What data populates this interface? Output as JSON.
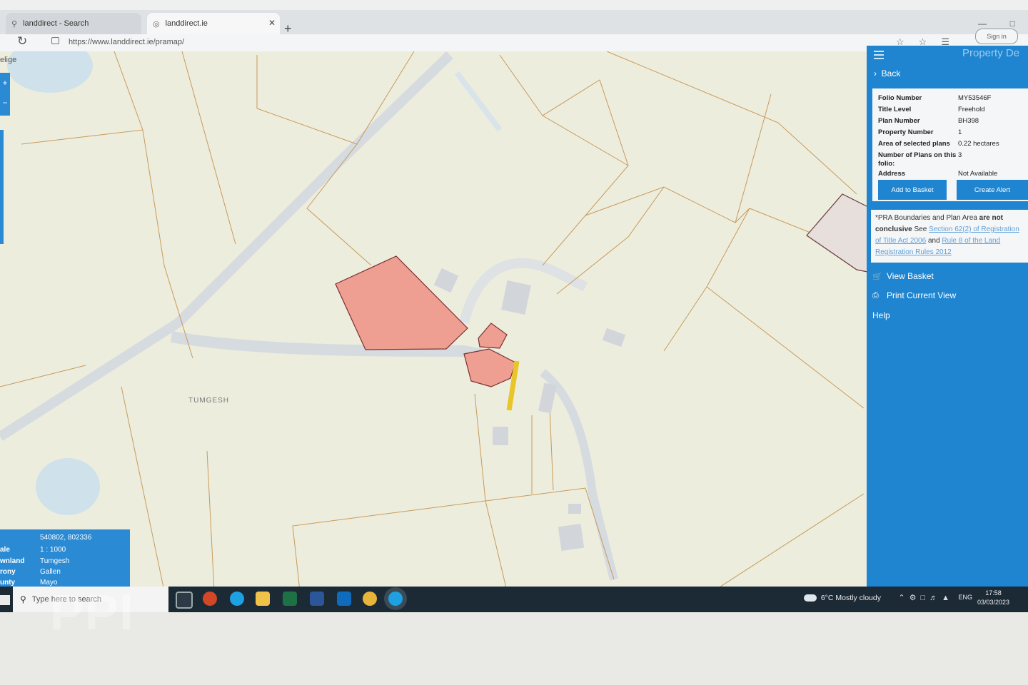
{
  "browser": {
    "tabs": [
      {
        "label": "landdirect - Search",
        "icon": "search-icon"
      },
      {
        "label": "landdirect.ie",
        "icon": "globe-icon"
      }
    ],
    "url": "https://www.landdirect.ie/pramap/",
    "signin_label": "Sign in"
  },
  "map": {
    "partial_label": "elige",
    "townland_label": "TUMGESH",
    "zoom_in": "+",
    "zoom_out": "−",
    "parcel_color": "#ef9f92",
    "boundary_color": "#c89a5a",
    "road_color": "#d6dbe0",
    "highlight_color": "#e8c62a"
  },
  "info_box": {
    "coords": "540802, 802336",
    "rows": [
      {
        "key": "ale",
        "value": "1 : 1000"
      },
      {
        "key": "wnland",
        "value": "Tumgesh"
      },
      {
        "key": "rony",
        "value": "Gallen"
      },
      {
        "key": "unty",
        "value": "Mayo"
      }
    ]
  },
  "panel": {
    "title": "Property De",
    "back_label": "Back",
    "details": [
      {
        "key": "Folio Number",
        "value": "MY53546F"
      },
      {
        "key": "Title Level",
        "value": "Freehold"
      },
      {
        "key": "Plan Number",
        "value": "BH398"
      },
      {
        "key": "Property Number",
        "value": "1"
      },
      {
        "key": "Area of selected plans",
        "value": "0.22 hectares"
      },
      {
        "key": "Number of Plans on this folio:",
        "value": "3"
      },
      {
        "key": "Address",
        "value": "Not Available"
      }
    ],
    "add_to_basket": "Add to Basket",
    "create_alert": "Create Alert",
    "notice": {
      "prefix": "*PRA Boundaries and Plan Area",
      "bold": "are not conclusive",
      "see": "See",
      "link1": "Section 62(2) of Registration of Title Act 2006",
      "and": "and",
      "link2": "Rule 8 of the Land Registration Rules 2012"
    },
    "links": [
      {
        "label": "View Basket",
        "icon": "cart-icon"
      },
      {
        "label": "Print Current View",
        "icon": "printer-icon"
      },
      {
        "label": "Help",
        "icon": ""
      }
    ],
    "accent": "#1f85d0"
  },
  "taskbar": {
    "search_placeholder": "Type here to search",
    "weather": "6°C  Mostly cloudy",
    "language": "ENG",
    "time": "17:58",
    "date": "03/03/2023"
  },
  "watermark": "PPI"
}
